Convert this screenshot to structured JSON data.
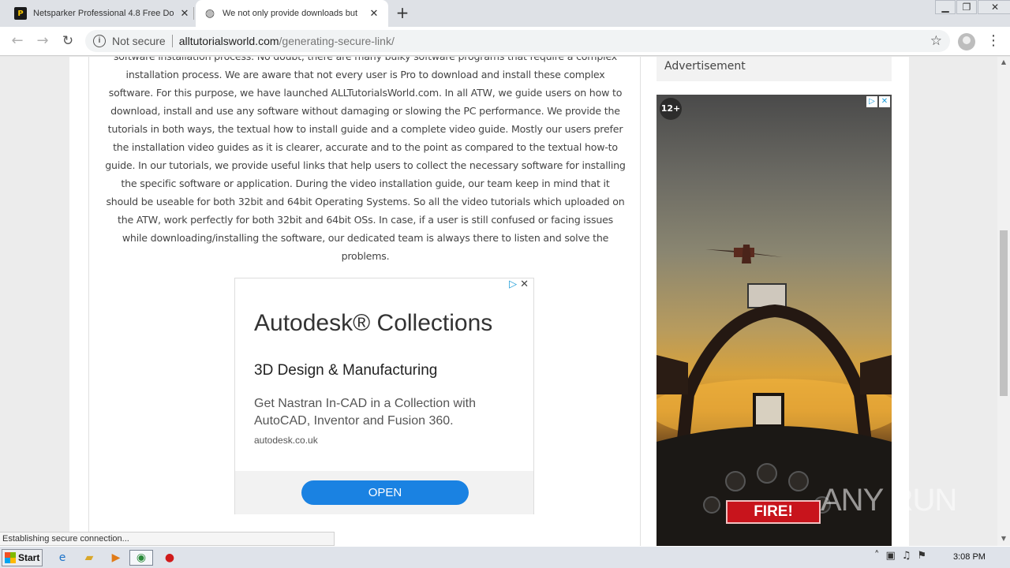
{
  "browser": {
    "tabs": [
      {
        "title": "Netsparker Professional 4.8 Free Do",
        "favicon": "netsparker-icon"
      },
      {
        "title": "We not only provide downloads but",
        "favicon": "globe-icon"
      }
    ],
    "address": {
      "security_label": "Not secure",
      "host": "alltutorialsworld.com",
      "path": "/generating-secure-link/"
    }
  },
  "article": {
    "paragraph": "software installation process. No doubt, there are many bulky software programs that require a complex installation process. We are aware that not every user is Pro to download and install these complex software. For this purpose, we have launched ALLTutorialsWorld.com. In all ATW, we guide users on how to download, install and use any software without damaging or slowing the PC performance. We provide the tutorials in both ways, the textual how to install guide and a complete video guide. Mostly our users prefer the installation video guides as it is clearer, accurate and to the point as compared to the textual how-to guide. In our tutorials, we provide useful links that help users to collect the necessary software for installing the specific software or application. During the video installation guide, our team keep in mind that it should be useable for both 32bit and 64bit Operating Systems. So all the video tutorials which uploaded on the ATW, work perfectly for both 32bit and 64bit OSs. In case, if a user is still confused or facing issues while downloading/installing the software, our dedicated team is always there to listen and solve the problems."
  },
  "ad": {
    "headline": "Autodesk® Collections",
    "subheadline": "3D Design & Manufacturing",
    "description": "Get Nastran In-CAD in a Collection with AutoCAD, Inventor and Fusion 360.",
    "domain": "autodesk.co.uk",
    "cta": "OPEN"
  },
  "sidebar": {
    "heading": "Advertisement",
    "game_ad": {
      "age_rating": "12+",
      "cta": "FIRE!"
    }
  },
  "status_text": "Establishing secure connection...",
  "watermark": "ANY RUN",
  "taskbar": {
    "start_label": "Start",
    "clock": "3:08 PM"
  },
  "colors": {
    "ad_button": "#1a82e2",
    "fire_button": "#c8141c",
    "adchoices": "#1a9bd7"
  }
}
